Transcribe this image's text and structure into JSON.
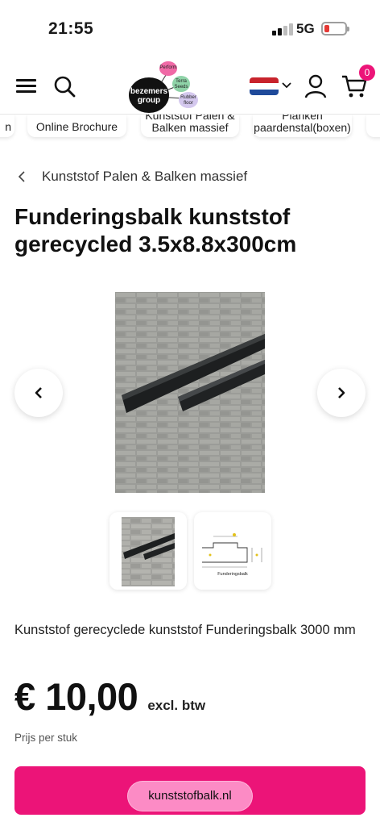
{
  "status_bar": {
    "time": "21:55",
    "network": "5G",
    "battery_level": 0.2
  },
  "header": {
    "logo": {
      "main_text": "bezemers group",
      "bubbles": [
        "Perform",
        "Terra Seeds",
        "Rubber floor"
      ]
    },
    "cart_count": "0",
    "language_flag": "netherlands-flag"
  },
  "categories": [
    {
      "label": "n"
    },
    {
      "label": "Online Brochure"
    },
    {
      "label_line1": "Kunststof Palen &",
      "label_line2": "Balken massief"
    },
    {
      "label_line1": "Planken",
      "label_line2": "paardenstal(boxen)"
    },
    {
      "label": ""
    }
  ],
  "breadcrumb": {
    "text": "Kunststof Palen & Balken massief"
  },
  "product": {
    "title": "Funderingsbalk kunststof gerecycled 3.5x8.8x300cm",
    "description": "Kunststof gerecyclede kunststof Funderingsbalk 3000 mm",
    "price": "€ 10,00",
    "price_suffix": "excl. btw",
    "price_unit": "Prijs per stuk",
    "thumbnails": [
      {
        "kind": "photo"
      },
      {
        "kind": "drawing",
        "caption": "Funderingsbalk"
      }
    ]
  },
  "bottom": {
    "url": "kunststofbalk.nl"
  },
  "colors": {
    "accent": "#ec1478",
    "text": "#111111"
  }
}
